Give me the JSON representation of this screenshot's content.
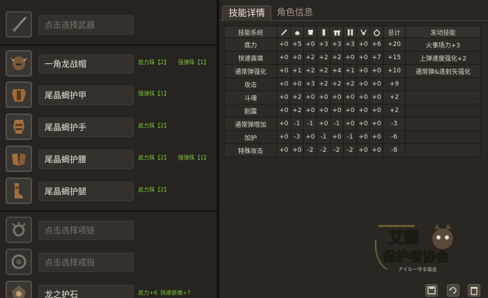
{
  "equipment": {
    "weapon": {
      "placeholder": "点击选择武器"
    },
    "slots": [
      {
        "name": "一角龙战帽",
        "jewels": [
          "底力珠【2】",
          "强弹珠【1】"
        ]
      },
      {
        "name": "尾晶蝎护甲",
        "jewels": [
          "强弹珠【1】"
        ]
      },
      {
        "name": "尾晶蝎护手",
        "jewels": [
          "底力珠【2】"
        ]
      },
      {
        "name": "尾晶蝎护腰",
        "jewels": [
          "底力珠【2】",
          "强弹珠【1】"
        ]
      },
      {
        "name": "尾晶蝎护腿",
        "jewels": [
          "底力珠【2】"
        ]
      }
    ],
    "necklace": {
      "placeholder": "点击选择项链"
    },
    "ring": {
      "placeholder": "点击选择戒指"
    },
    "charm": {
      "name": "龙之护石",
      "jewels": [
        "底力+6",
        "快速装填+7"
      ]
    }
  },
  "tabs": {
    "active": "技能详情",
    "inactive": "角色信息"
  },
  "table": {
    "header_name": "技能系统",
    "header_total": "总计",
    "header_activated": "发动技能",
    "column_icons": [
      "weapon-icon",
      "helmet-icon",
      "chest-icon",
      "arms-icon",
      "waist-icon",
      "legs-icon",
      "necklace-icon",
      "ring-icon"
    ],
    "rows": [
      {
        "name": "底力",
        "values": [
          "+0",
          "+5",
          "+0",
          "+3",
          "+3",
          "+3",
          "+0",
          "+6"
        ],
        "total": "+20",
        "activated": "火事场力+3"
      },
      {
        "name": "快速装填",
        "values": [
          "+0",
          "+0",
          "+2",
          "+2",
          "+2",
          "+0",
          "+0",
          "+7"
        ],
        "total": "+15",
        "activated": "上弹速度强化+2"
      },
      {
        "name": "通常弹强化",
        "values": [
          "+0",
          "+1",
          "+2",
          "+2",
          "+4",
          "+1",
          "+0",
          "+0"
        ],
        "total": "+10",
        "activated": "通常弹&连射矢强化"
      },
      {
        "name": "攻击",
        "values": [
          "+0",
          "+0",
          "+3",
          "+2",
          "+2",
          "+2",
          "+0",
          "+0"
        ],
        "total": "+9",
        "activated": ""
      },
      {
        "name": "斗魂",
        "values": [
          "+0",
          "+2",
          "+0",
          "+0",
          "+0",
          "+0",
          "+0",
          "+0"
        ],
        "total": "+2",
        "activated": ""
      },
      {
        "name": "耐震",
        "values": [
          "+0",
          "+2",
          "+0",
          "+0",
          "+0",
          "+0",
          "+0",
          "+0"
        ],
        "total": "+2",
        "activated": ""
      },
      {
        "name": "通常弹增加",
        "values": [
          "+0",
          "-1",
          "-1",
          "+0",
          "-1",
          "+0",
          "+0",
          "+0"
        ],
        "total": "-3",
        "activated": ""
      },
      {
        "name": "加护",
        "values": [
          "+0",
          "-3",
          "+0",
          "-1",
          "+0",
          "-1",
          "+0",
          "+0"
        ],
        "total": "-6",
        "activated": ""
      },
      {
        "name": "特殊攻击",
        "values": [
          "+0",
          "+0",
          "-2",
          "-2",
          "-2",
          "-2",
          "+0",
          "+0"
        ],
        "total": "-8",
        "activated": ""
      }
    ]
  },
  "logo": {
    "line1": "艾露",
    "line2": "保护者协会",
    "sub": "アイルー守る協会"
  },
  "colors": {
    "jewel_text": "#7fc43a",
    "logo_green": "#8cd02a"
  },
  "bottom_buttons": [
    "save-icon",
    "refresh-icon",
    "trash-icon"
  ]
}
